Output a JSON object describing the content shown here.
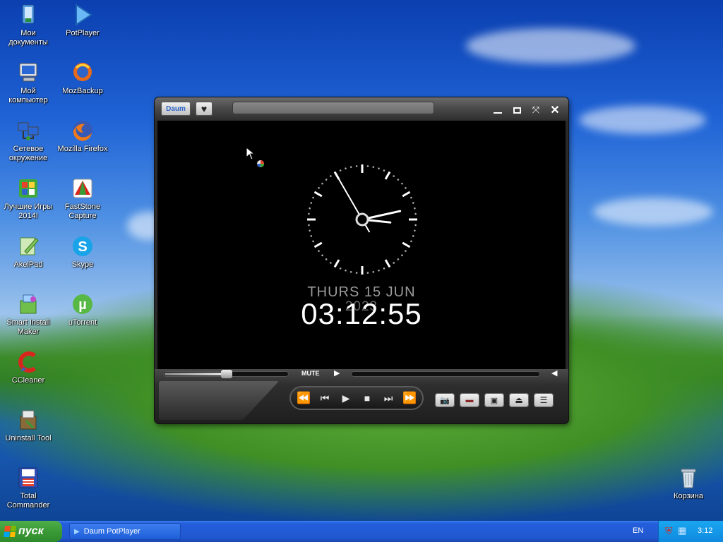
{
  "desktop": {
    "icons": [
      {
        "label": "Мои\nдокументы",
        "icon": "my-documents-icon"
      },
      {
        "label": "PotPlayer",
        "icon": "potplayer-icon"
      },
      {
        "label": "Мой\nкомпьютер",
        "icon": "my-computer-icon"
      },
      {
        "label": "MozBackup",
        "icon": "mozbackup-icon"
      },
      {
        "label": "Сетевое\nокружение",
        "icon": "network-icon"
      },
      {
        "label": "Mozilla Firefox",
        "icon": "firefox-icon"
      },
      {
        "label": "Лучшие Игры\n2014!",
        "icon": "games-icon"
      },
      {
        "label": "FastStone\nCapture",
        "icon": "faststone-icon"
      },
      {
        "label": "AkelPad",
        "icon": "akelpad-icon"
      },
      {
        "label": "Skype",
        "icon": "skype-icon"
      },
      {
        "label": "Smart Install\nMaker",
        "icon": "smart-install-icon"
      },
      {
        "label": "uTorrent",
        "icon": "utorrent-icon"
      },
      {
        "label": "CCleaner",
        "icon": "ccleaner-icon"
      },
      {
        "label": "Uninstall Tool",
        "icon": "uninstall-tool-icon"
      },
      {
        "label": "Total\nCommander",
        "icon": "total-commander-icon"
      },
      {
        "label": "Корзина",
        "icon": "recycle-bin-icon"
      }
    ]
  },
  "player": {
    "logo": "Daum",
    "clock": {
      "date": "THURS 15 JUN",
      "year": "2023",
      "time": "03:12:55",
      "hours": 3,
      "minutes": 12,
      "seconds": 55
    },
    "mute_label": "MUTE",
    "seek_progress": 0,
    "volume_level": 0.49
  },
  "taskbar": {
    "start_label": "пуск",
    "task_label": "Daum PotPlayer",
    "language": "EN",
    "time": "3:12"
  },
  "colors": {
    "xp_taskbar": "#245edb",
    "start_green": "#3a9a36",
    "player_dark": "#2a2a2a"
  }
}
